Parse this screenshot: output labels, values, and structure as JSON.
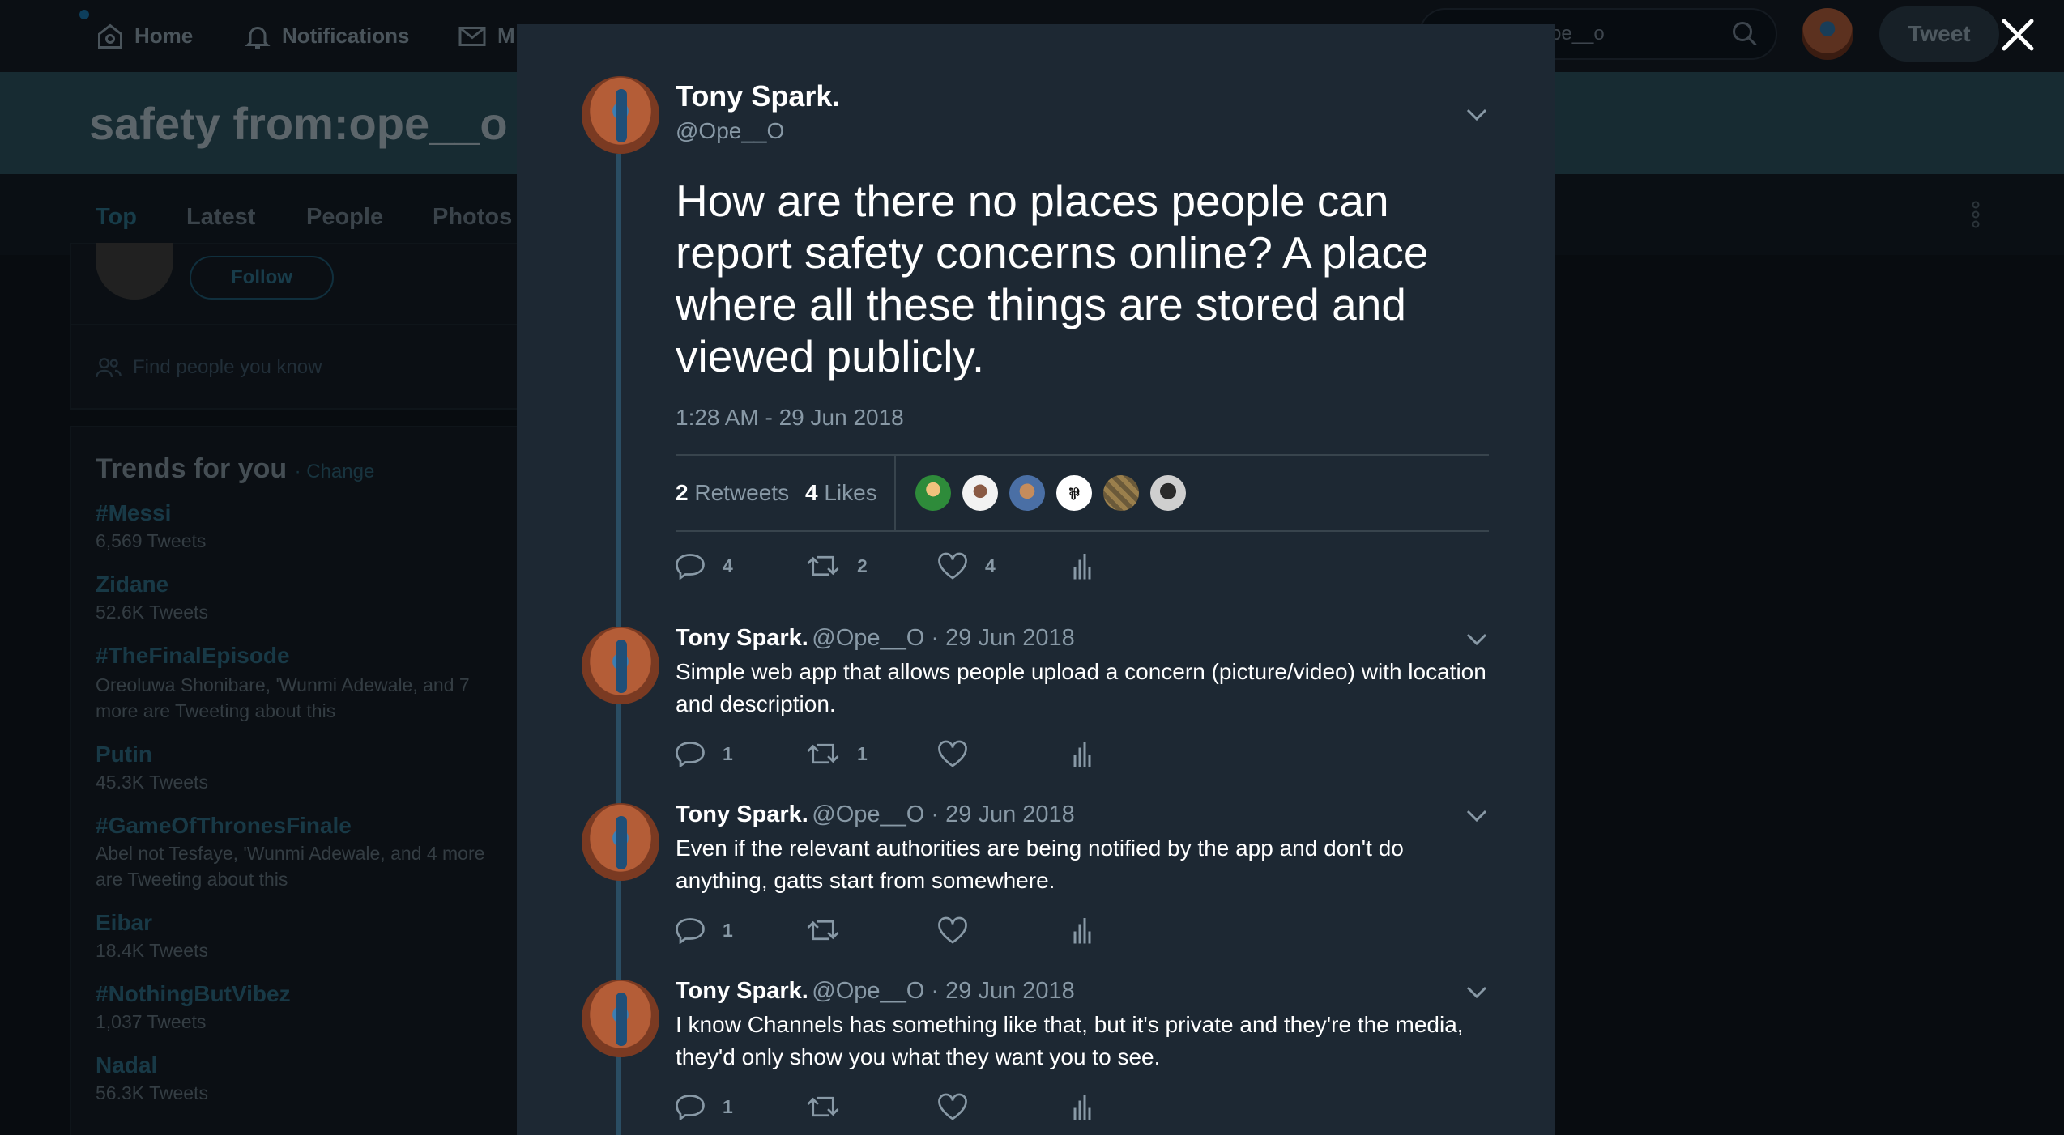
{
  "nav": {
    "home": "Home",
    "notifications": "Notifications",
    "messages_partial": "M",
    "search_value": "pe__o",
    "tweet_button": "Tweet"
  },
  "search_page": {
    "title": "safety from:ope__o",
    "tabs": [
      "Top",
      "Latest",
      "People",
      "Photos"
    ],
    "follow_button": "Follow",
    "find_people": "Find people you know",
    "trends_title": "Trends for you",
    "trends_change": "· Change",
    "trends": [
      {
        "name": "#Messi",
        "meta": "6,569 Tweets"
      },
      {
        "name": "Zidane",
        "meta": "52.6K Tweets"
      },
      {
        "name": "#TheFinalEpisode",
        "meta": "Oreoluwa Shonibare, 'Wunmi Adewale, and 7 more are Tweeting about this"
      },
      {
        "name": "Putin",
        "meta": "45.3K Tweets"
      },
      {
        "name": "#GameOfThronesFinale",
        "meta": "Abel not Tesfaye, 'Wunmi Adewale, and 4 more are Tweeting about this"
      },
      {
        "name": "Eibar",
        "meta": "18.4K Tweets"
      },
      {
        "name": "#NothingButVibez",
        "meta": "1,037 Tweets"
      },
      {
        "name": "Nadal",
        "meta": "56.3K Tweets"
      }
    ]
  },
  "main_tweet": {
    "name": "Tony Spark.",
    "handle": "@Ope__O",
    "text": "How are there no places people can report safety concerns online? A place where all these things are stored and viewed publicly.",
    "timestamp": "1:28 AM - 29 Jun 2018",
    "retweets_count": "2",
    "retweets_label": "Retweets",
    "likes_count": "4",
    "likes_label": "Likes",
    "reply_count": "4",
    "retweet_count": "2",
    "like_count": "4"
  },
  "replies": [
    {
      "name": "Tony Spark.",
      "meta": "@Ope__O · 29 Jun 2018",
      "text": "Simple web app that allows people upload a concern (picture/video) with location and description.",
      "reply_count": "1",
      "retweet_count": "1",
      "like_count": ""
    },
    {
      "name": "Tony Spark.",
      "meta": "@Ope__O · 29 Jun 2018",
      "text": "Even if the relevant authorities are being notified by the app and don't do anything, gatts start from somewhere.",
      "reply_count": "1",
      "retweet_count": "",
      "like_count": ""
    },
    {
      "name": "Tony Spark.",
      "meta": "@Ope__O · 29 Jun 2018",
      "text": "I know Channels has something like that, but it's private and they're the media, they'd only show you what they want you to see.",
      "reply_count": "1",
      "retweet_count": "",
      "like_count": ""
    }
  ],
  "colors": {
    "modal_bg": "#1d2833",
    "text_secondary": "#8899a6",
    "thread_line": "#2a4d63"
  },
  "icons": [
    "home-icon",
    "bell-icon",
    "mail-icon",
    "search-icon",
    "close-icon",
    "chevron-down-icon",
    "reply-icon",
    "retweet-icon",
    "heart-icon",
    "analytics-icon",
    "people-icon"
  ]
}
